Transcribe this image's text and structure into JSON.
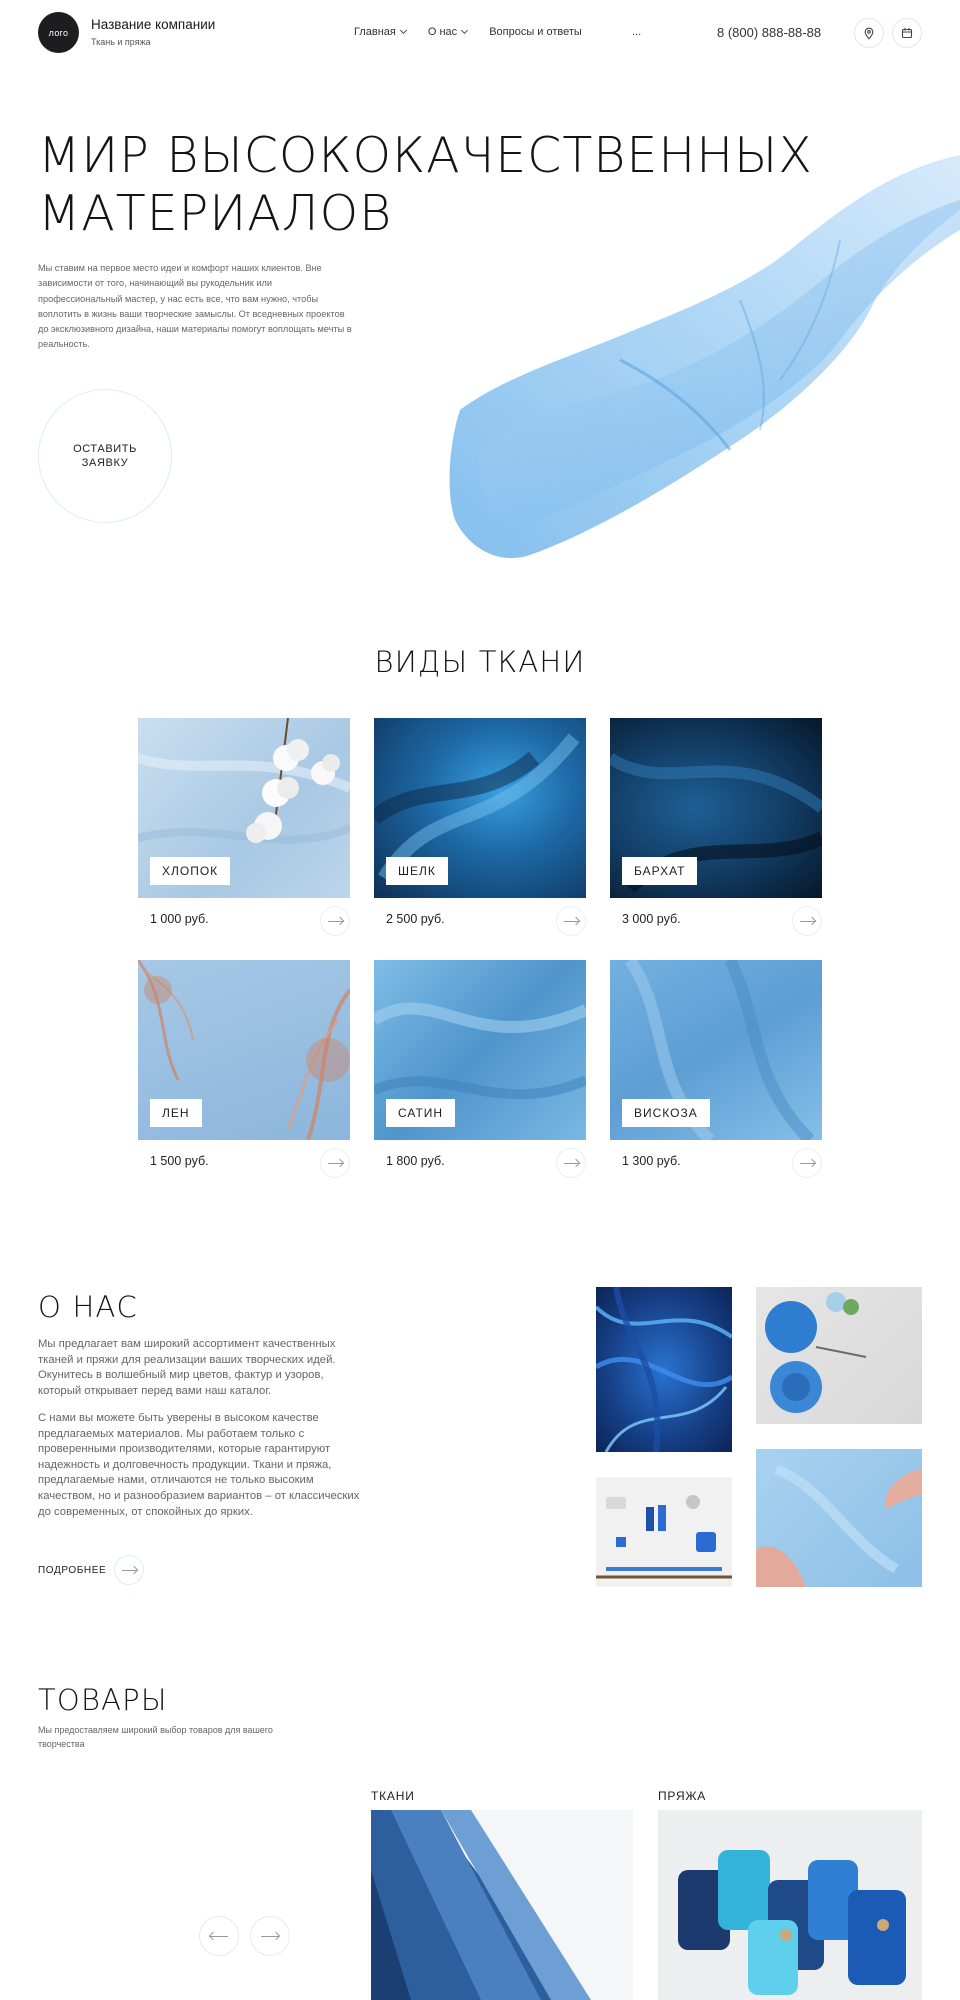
{
  "header": {
    "logo": "лого",
    "company_name": "Название компании",
    "company_sub": "Ткань и пряжа",
    "nav": [
      {
        "label": "Главная",
        "dropdown": true
      },
      {
        "label": "О нас",
        "dropdown": true
      },
      {
        "label": "Вопросы и ответы",
        "dropdown": false
      }
    ],
    "nav_more": "...",
    "phone": "8 (800) 888-88-88",
    "icons": [
      "map-pin-icon",
      "calendar-icon"
    ]
  },
  "hero": {
    "title_line1": "Мир высококачественных",
    "title_line2": "материалов",
    "text": "Мы ставим на первое место идеи и комфорт наших клиентов. Вне зависимости от того, начинающий вы рукодельник или профессиональный мастер, у нас есть все, что вам нужно, чтобы воплотить в жизнь ваши творческие замыслы. От вседневных проектов до эксклюзивного дизайна, наши материалы помогут воплощать мечты в реальность.",
    "cta_line1": "Оставить",
    "cta_line2": "заявку"
  },
  "fabrics": {
    "title": "Виды ткани",
    "items": [
      {
        "label": "Хлопок",
        "price": "1 000 руб."
      },
      {
        "label": "Шелк",
        "price": "2 500 руб."
      },
      {
        "label": "Бархат",
        "price": "3 000 руб."
      },
      {
        "label": "Лен",
        "price": "1 500 руб."
      },
      {
        "label": "Сатин",
        "price": "1 800 руб."
      },
      {
        "label": "Вискоза",
        "price": "1 300 руб."
      }
    ]
  },
  "about": {
    "title": "О нас",
    "p1": "Мы предлагает вам широкий ассортимент качественных тканей и пряжи для реализации ваших творческих идей. Окунитесь в волшебный мир цветов, фактур и узоров, который открывает перед вами наш каталог.",
    "p2": "С нами вы можете быть уверены в высоком качестве предлагаемых материалов. Мы работаем только с проверенными производителями, которые гарантируют надежность и долговечность продукции. Ткани и пряжа, предлагаемые нами, отличаются не только высоким качеством, но и разнообразием вариантов – от классических до современных, от спокойных до ярких.",
    "more": "Подробнее"
  },
  "products": {
    "title": "Товары",
    "subtitle": "Мы предоставляем широкий выбор товаров для вашего творчества",
    "categories": [
      "Ткани",
      "Пряжа"
    ]
  },
  "colors": {
    "accent": "#7fbde8",
    "dark": "#1d1d1f"
  }
}
